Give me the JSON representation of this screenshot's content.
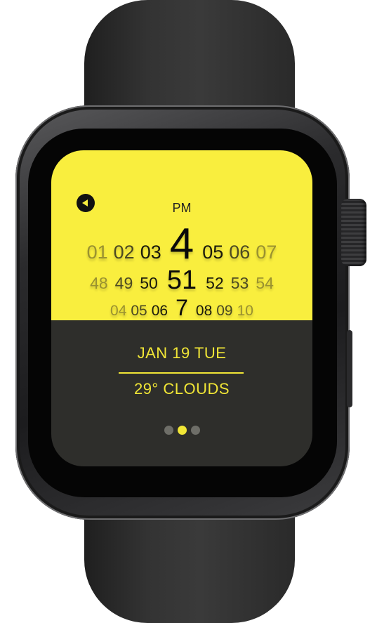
{
  "watch": {
    "colors": {
      "accent": "#f9ee3e",
      "screen_dark": "#2e2e2b",
      "band": "#333333"
    },
    "back_icon": "back-arrow-icon",
    "ampm": "PM",
    "hours": {
      "left": [
        "01",
        "02",
        "03"
      ],
      "current": "4",
      "right": [
        "05",
        "06",
        "07"
      ]
    },
    "minutes": {
      "left": [
        "48",
        "49",
        "50"
      ],
      "current": "51",
      "right": [
        "52",
        "53",
        "54"
      ]
    },
    "seconds": {
      "left": [
        "04",
        "05",
        "06"
      ],
      "current": "7",
      "right": [
        "08",
        "09",
        "10"
      ]
    },
    "date": "JAN 19 TUE",
    "weather": "29° CLOUDS",
    "pager": {
      "count": 3,
      "active_index": 1
    }
  }
}
